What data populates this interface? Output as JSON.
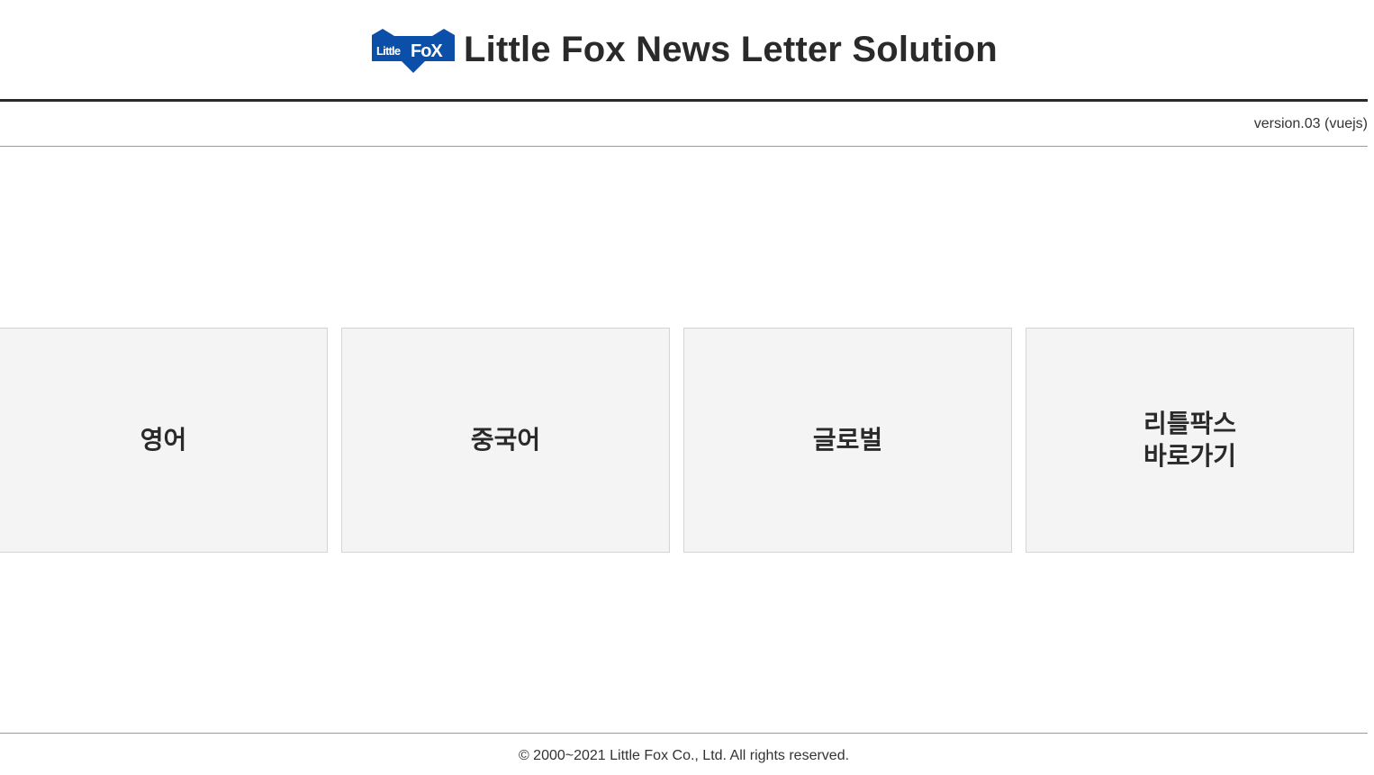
{
  "header": {
    "logo_text": "Little FoX",
    "title": "Little Fox News Letter Solution"
  },
  "version": "version.03 (vuejs)",
  "menu": {
    "items": [
      {
        "label": "영어"
      },
      {
        "label": "중국어"
      },
      {
        "label": "글로벌"
      },
      {
        "label": "리틀팍스\n바로가기"
      }
    ]
  },
  "footer": {
    "copyright": "© 2000~2021 Little Fox Co., Ltd. All rights reserved."
  },
  "colors": {
    "logo_blue": "#0b4fa8",
    "card_background": "#f4f4f4",
    "text": "#2a2a2a"
  }
}
